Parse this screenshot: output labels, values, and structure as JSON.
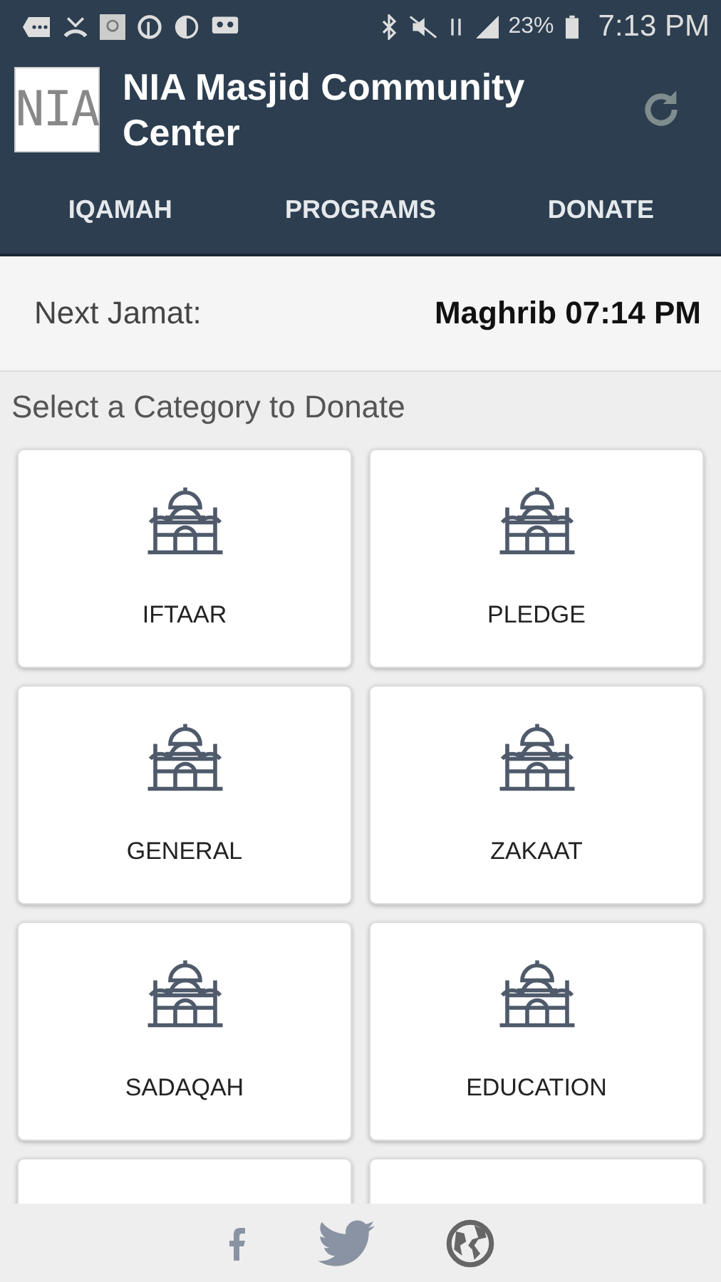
{
  "status_bar": {
    "battery": "23%",
    "time": "7:13 PM"
  },
  "app_bar": {
    "logo": "NIA",
    "title": "NIA Masjid Community Center"
  },
  "tabs": [
    {
      "label": "IQAMAH"
    },
    {
      "label": "PROGRAMS"
    },
    {
      "label": "DONATE"
    }
  ],
  "next_jamat": {
    "label": "Next Jamat:",
    "value": "Maghrib 07:14 PM"
  },
  "section_title": "Select a Category to Donate",
  "categories": [
    {
      "kind": "card",
      "label": "IFTAAR"
    },
    {
      "kind": "card",
      "label": "PLEDGE"
    },
    {
      "kind": "card",
      "label": "GENERAL"
    },
    {
      "kind": "card",
      "label": "ZAKAAT"
    },
    {
      "kind": "card",
      "label": "SADAQAH"
    },
    {
      "kind": "card",
      "label": "EDUCATION"
    },
    {
      "kind": "cutoff"
    },
    {
      "kind": "cutoff"
    }
  ],
  "footer": {
    "links": [
      {
        "kind": "facebook"
      },
      {
        "kind": "twitter"
      },
      {
        "kind": "website"
      }
    ]
  }
}
